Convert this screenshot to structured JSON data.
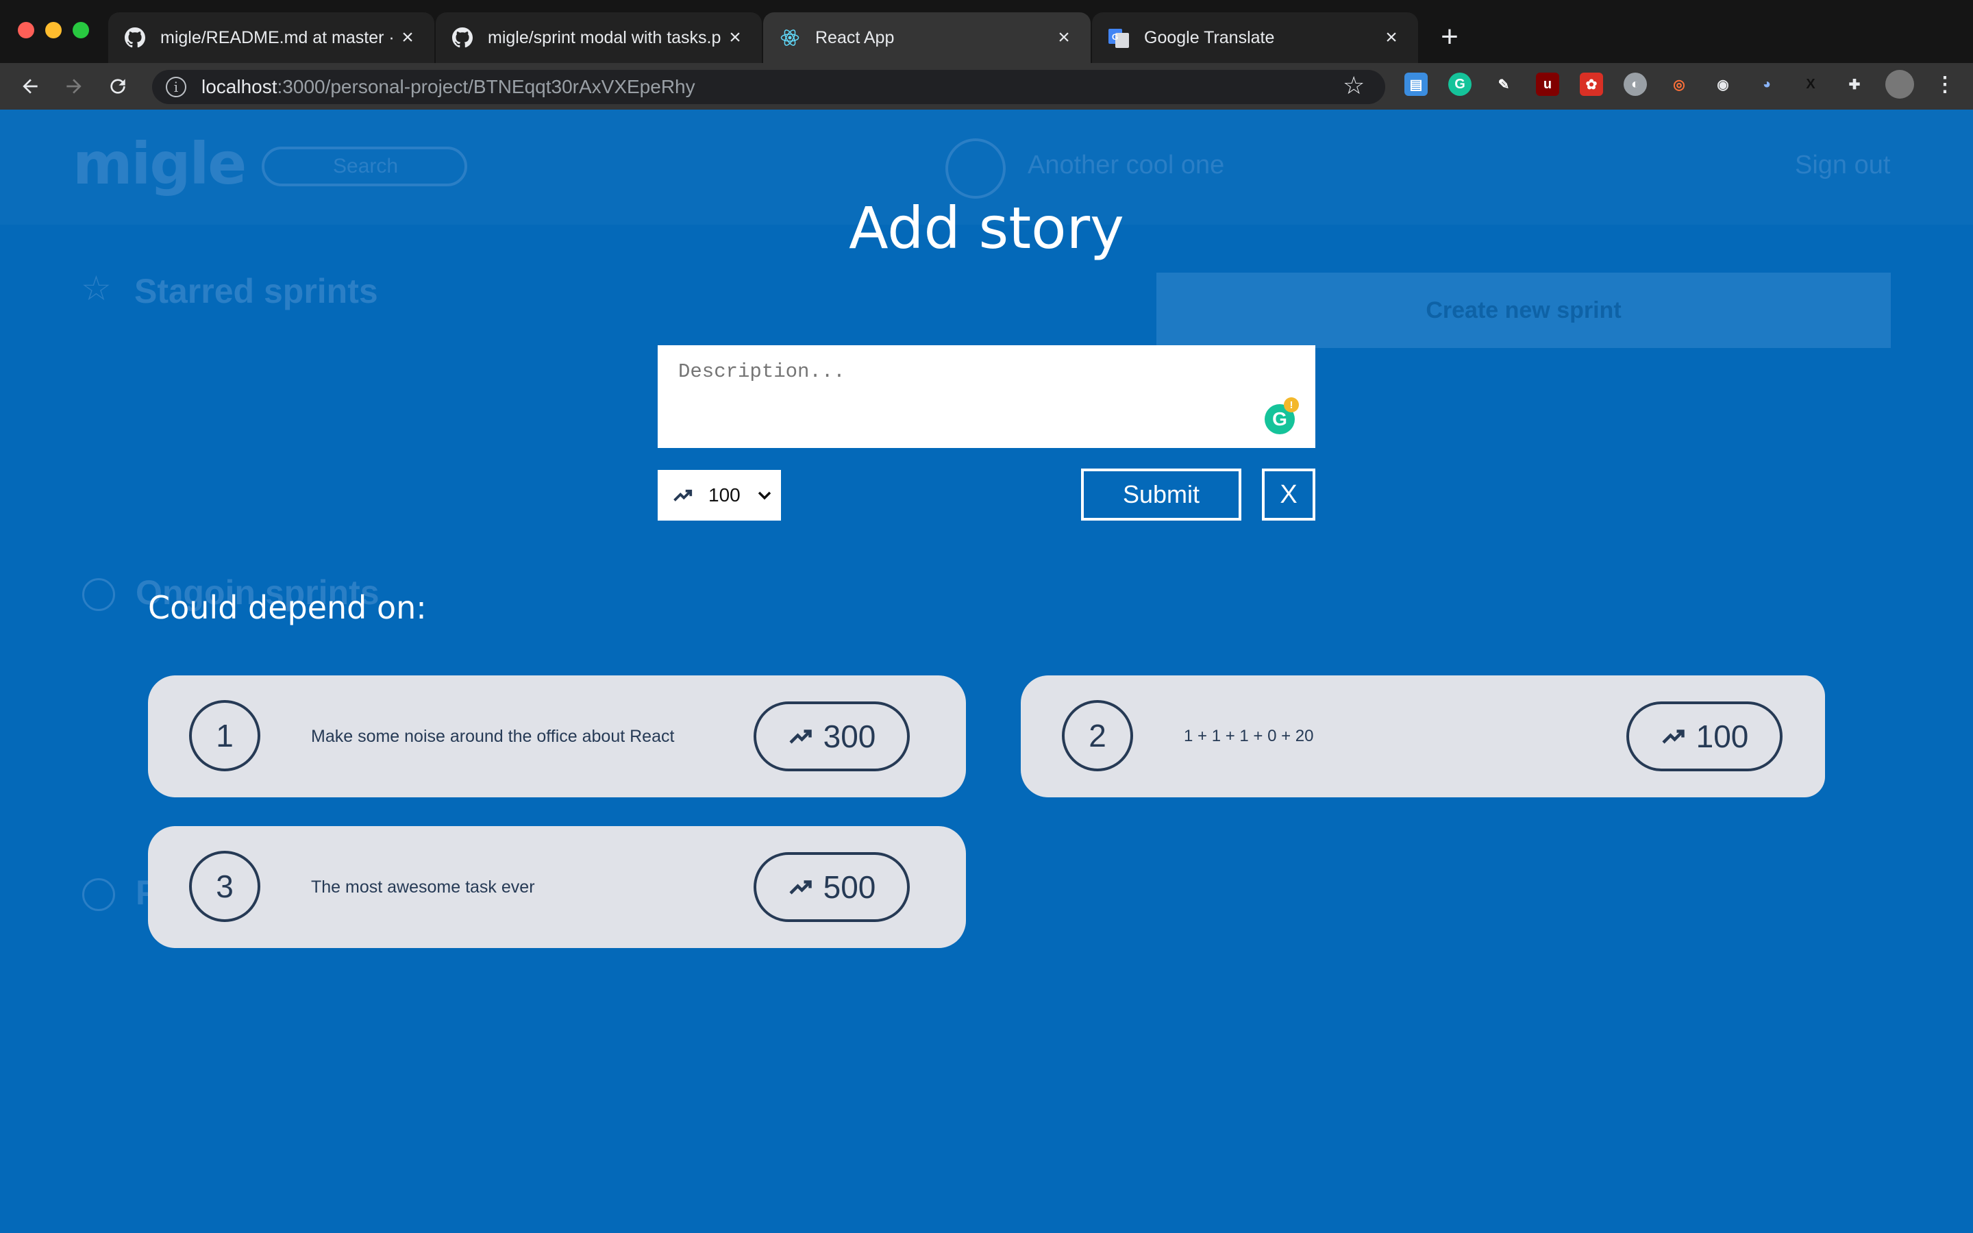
{
  "browser": {
    "tabs": [
      {
        "title": "migle/README.md at master · ",
        "favicon": "github-icon",
        "active": false
      },
      {
        "title": "migle/sprint modal with tasks.p",
        "favicon": "github-icon",
        "active": false
      },
      {
        "title": "React App",
        "favicon": "react-icon",
        "active": true
      },
      {
        "title": "Google Translate",
        "favicon": "google-translate-icon",
        "active": false
      }
    ],
    "url_host": "localhost",
    "url_path": ":3000/personal-project/BTNEqqt30rAxVXEpeRhy"
  },
  "background": {
    "logo": "migle",
    "search_placeholder": "Search",
    "project_name": "Another cool one",
    "sign_out": "Sign out",
    "starred_title": "Starred sprints",
    "create_sprint": "Create new sprint",
    "ongoing_title": "Ongoin sprints",
    "letter": "P"
  },
  "modal": {
    "title": "Add story",
    "description_placeholder": "Description...",
    "points_value": "100",
    "submit_label": "Submit",
    "close_label": "X",
    "depends_title": "Could depend on:"
  },
  "stories": [
    {
      "number": "1",
      "description": "Make some noise around the office about React",
      "points": "300"
    },
    {
      "number": "2",
      "description": "1 + 1 + 1 + 0 + 20",
      "points": "100"
    },
    {
      "number": "3",
      "description": "The most awesome task ever",
      "points": "500"
    }
  ],
  "colors": {
    "page_bg": "#0469b9",
    "card_bg": "#e0e2e8",
    "card_text": "#263a55"
  }
}
